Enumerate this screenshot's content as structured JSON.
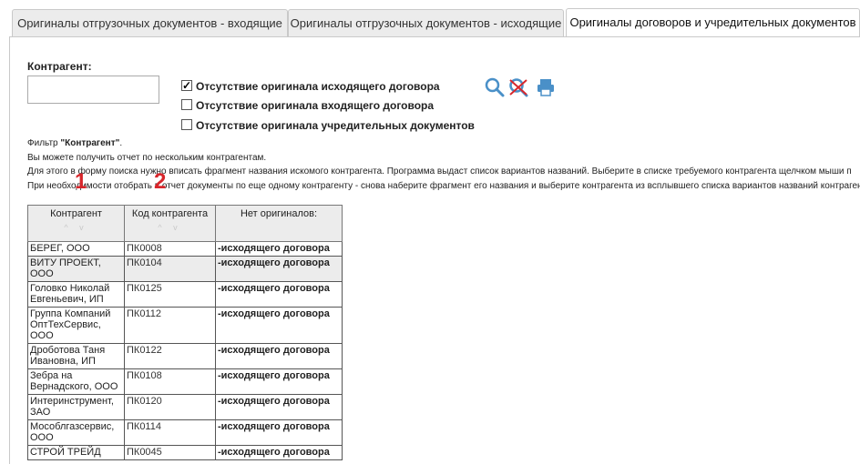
{
  "tabs": [
    {
      "label": "Оригиналы отгрузочных документов - входящие",
      "active": false
    },
    {
      "label": "Оригиналы отгрузочных документов - исходящие",
      "active": false
    },
    {
      "label": "Оригиналы договоров и учредительных документов",
      "active": true
    }
  ],
  "filter": {
    "counterparty_label": "Контрагент:",
    "counterparty_value": "",
    "checkboxes": [
      {
        "label": "Отсутствие оригинала исходящего договора",
        "checked": true
      },
      {
        "label": "Отсутствие оригинала входящего договора",
        "checked": false
      },
      {
        "label": "Отсутствие оригинала учредительных документов",
        "checked": false
      }
    ],
    "icons": [
      "search-icon",
      "clear-search-icon",
      "print-icon"
    ]
  },
  "info": {
    "line1_prefix": "Фильтр ",
    "line1_bold": "\"Контрагент\"",
    "line1_suffix": ".",
    "line2": "Вы можете получить отчет по нескольким контрагентам.",
    "line3": "Для этого в форму поиска нужно вписать фрагмент названия искомого контрагента. Программа выдаст список вариантов названий. Выберите в списке требуемого контрагента щелчком мыши п",
    "line4": "При необходимости отобрать в отчет документы по еще одному контрагенту - снова наберите фрагмент его названия и выберите контрагента из всплывшего списка вариантов названий контрагентов"
  },
  "markers": [
    "1",
    "2"
  ],
  "table": {
    "headers": [
      "Контрагент",
      "Код контрагента",
      "Нет оригиналов:"
    ],
    "sort_glyph": "^ v",
    "rows": [
      {
        "name": "БЕРЕГ, ООО",
        "code": "ПК0008",
        "status": "-исходящего договора"
      },
      {
        "name": "ВИТУ ПРОЕКТ, ООО",
        "code": "ПК0104",
        "status": "-исходящего договора"
      },
      {
        "name": "Головко Николай Евгеньевич, ИП",
        "code": "ПК0125",
        "status": "-исходящего договора"
      },
      {
        "name": "Группа Компаний ОптТехСервис, ООО",
        "code": "ПК0112",
        "status": "-исходящего договора"
      },
      {
        "name": "Дроботова Таня Ивановна, ИП",
        "code": "ПК0122",
        "status": "-исходящего договора"
      },
      {
        "name": "Зебра на Вернадского, ООО",
        "code": "ПК0108",
        "status": "-исходящего договора"
      },
      {
        "name": "Интеринструмент, ЗАО",
        "code": "ПК0120",
        "status": "-исходящего договора"
      },
      {
        "name": "Мособлгазсервис, ООО",
        "code": "ПК0114",
        "status": "-исходящего договора"
      },
      {
        "name": "СТРОЙ ТРЕЙД",
        "code": "ПК0045",
        "status": "-исходящего договора"
      }
    ]
  },
  "colors": {
    "accent_icon": "#4a90c8",
    "marker": "#d8262b",
    "clear_x": "#d8262b"
  }
}
